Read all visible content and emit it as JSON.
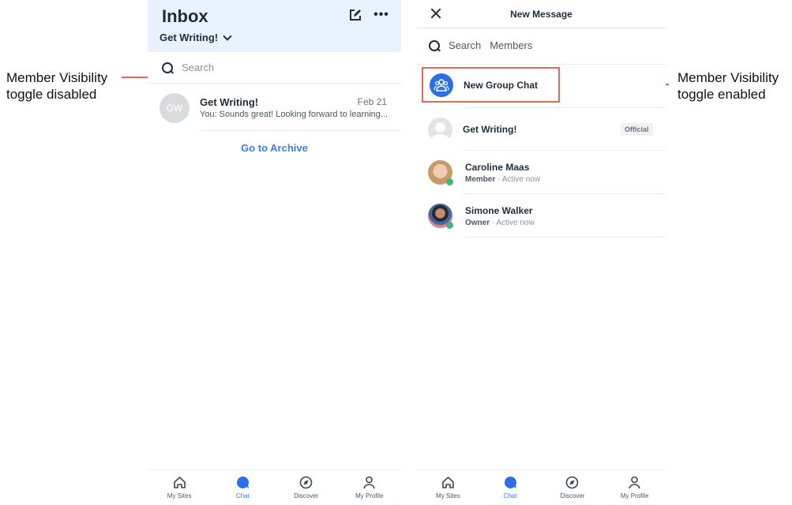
{
  "annotations": {
    "left": {
      "line1": "Member Visibility",
      "line2": "toggle disabled"
    },
    "right": {
      "line1": "Member Visibility",
      "line2": "toggle enabled"
    },
    "arrow_color": "#e06a56"
  },
  "inbox": {
    "title": "Inbox",
    "site_name": "Get Writing!",
    "search_placeholder": "Search",
    "conversations": [
      {
        "avatar_initials": "GW",
        "name": "Get Writing!",
        "date": "Feb 21",
        "preview": "You: Sounds great! Looking forward to learning..."
      }
    ],
    "archive_link": "Go to Archive"
  },
  "new_message": {
    "title": "New Message",
    "search_placeholder": "Search",
    "search_scope": "Members",
    "new_group_chat": "New Group Chat",
    "members": [
      {
        "name": "Get Writing!",
        "badge": "Official"
      },
      {
        "name": "Caroline Maas",
        "role": "Member",
        "status": "Active now"
      },
      {
        "name": "Simone Walker",
        "role": "Owner",
        "status": "Active now"
      }
    ]
  },
  "tabbar": {
    "tabs": [
      {
        "label": "My Sites",
        "icon": "home-icon"
      },
      {
        "label": "Chat",
        "icon": "chat-bubble-icon",
        "active": true
      },
      {
        "label": "Discover",
        "icon": "compass-icon"
      },
      {
        "label": "My Profile",
        "icon": "person-icon"
      }
    ]
  },
  "colors": {
    "accent": "#3b7cf1",
    "header_bg": "#e9f1fc",
    "online": "#3fb57a",
    "highlight_border": "#e06a56"
  }
}
